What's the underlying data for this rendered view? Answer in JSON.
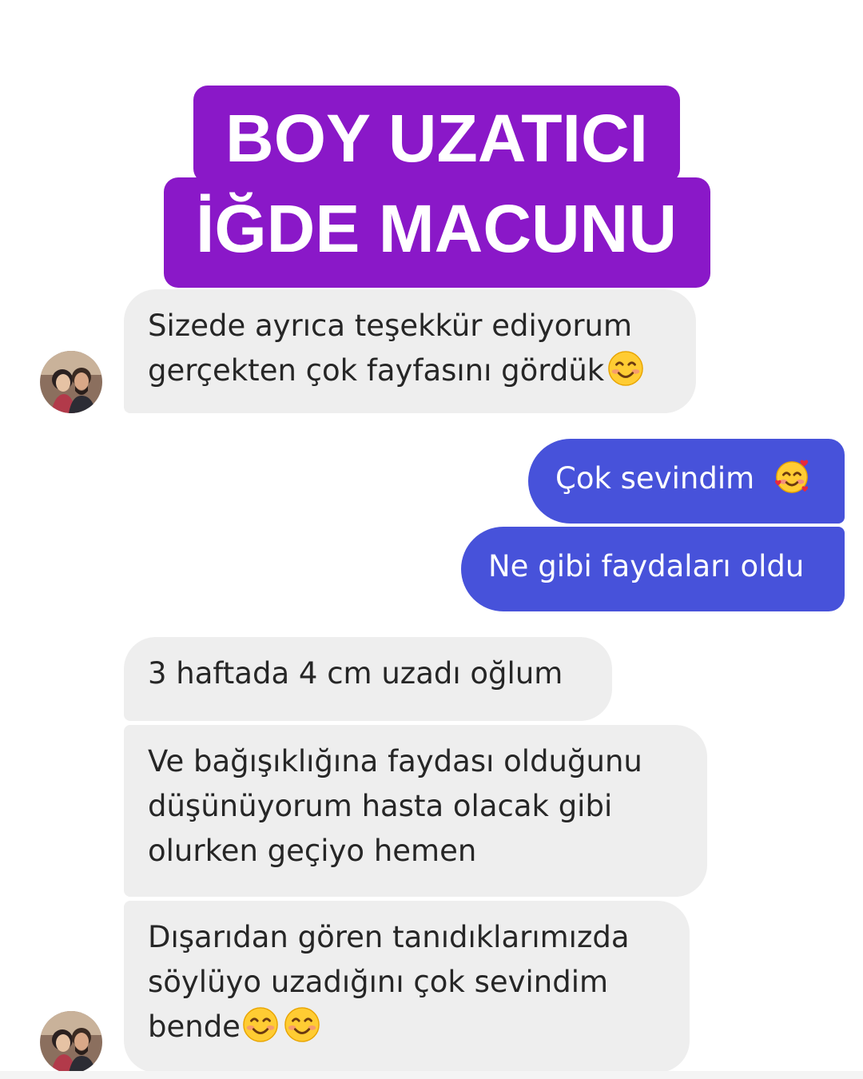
{
  "banner": {
    "line1": "BOY UZATICI",
    "line2": "İĞDE MACUNU",
    "color": "#8a18c8"
  },
  "messages": [
    {
      "direction": "incoming",
      "lines": [
        "Sizede ayrıca teşekkür ediyorum",
        "gerçekten çok fayfasını gördük"
      ],
      "emojis": [
        "smiling-face-icon"
      ]
    },
    {
      "direction": "outgoing",
      "lines": [
        "Çok sevindim"
      ],
      "emojis": [
        "smiling-face-with-hearts-icon"
      ]
    },
    {
      "direction": "outgoing",
      "lines": [
        "Ne gibi faydaları oldu"
      ],
      "emojis": []
    },
    {
      "direction": "incoming",
      "lines": [
        "3 haftada 4 cm uzadı oğlum"
      ],
      "emojis": []
    },
    {
      "direction": "incoming",
      "lines": [
        "Ve bağışıklığına faydası olduğunu",
        "düşünüyorum hasta olacak gibi",
        "olurken geçiyo hemen"
      ],
      "emojis": []
    },
    {
      "direction": "incoming",
      "lines": [
        "Dışarıdan gören tanıdıklarımızda",
        "söylüyo uzadığını çok sevindim",
        "bende"
      ],
      "emojis": [
        "smiling-face-icon",
        "smiling-face-icon"
      ]
    }
  ],
  "colors": {
    "incoming_bubble": "#eeeeee",
    "outgoing_bubble": "#4752da",
    "incoming_text": "#262626",
    "outgoing_text": "#ffffff"
  }
}
